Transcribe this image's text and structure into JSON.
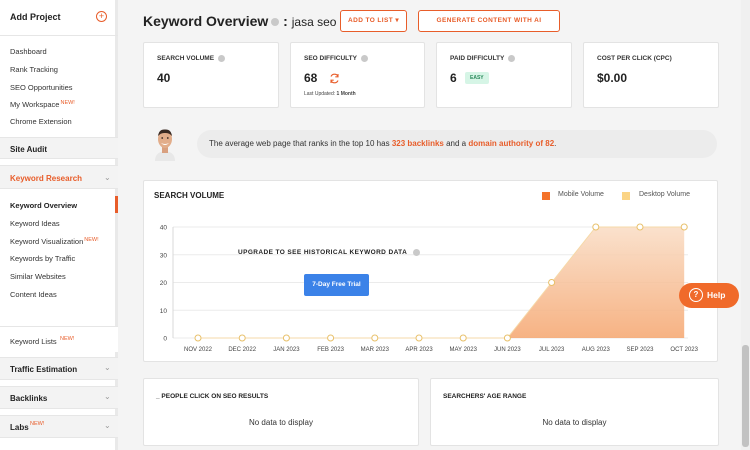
{
  "sidebar": {
    "add_project": "Add Project",
    "links_top": [
      {
        "label": "Dashboard",
        "new": ""
      },
      {
        "label": "Rank Tracking",
        "new": ""
      },
      {
        "label": "SEO Opportunities",
        "new": ""
      },
      {
        "label": "My Workspace",
        "new": "NEW!"
      },
      {
        "label": "Chrome Extension",
        "new": ""
      }
    ],
    "site_audit": "Site Audit",
    "keyword_research": "Keyword Research",
    "kr_links": [
      {
        "label": "Keyword Overview",
        "new": ""
      },
      {
        "label": "Keyword Ideas",
        "new": ""
      },
      {
        "label": "Keyword Visualization",
        "new": "NEW!"
      },
      {
        "label": "Keywords by Traffic",
        "new": ""
      },
      {
        "label": "Similar Websites",
        "new": ""
      },
      {
        "label": "Content Ideas",
        "new": ""
      }
    ],
    "keyword_lists": {
      "label": "Keyword Lists",
      "new": "NEW!"
    },
    "traffic_estimation": "Traffic Estimation",
    "backlinks": "Backlinks",
    "labs": {
      "label": "Labs",
      "new": "NEW!"
    }
  },
  "header": {
    "title": "Keyword Overview",
    "separator": ":",
    "keyword": "jasa seo",
    "add_to_list": "ADD TO LIST",
    "generate": "GENERATE CONTENT WITH AI"
  },
  "metrics": {
    "search_volume": {
      "label": "SEARCH VOLUME",
      "value": "40"
    },
    "seo_difficulty": {
      "label": "SEO DIFFICULTY",
      "value": "68",
      "updated_label": "Last Updated:",
      "updated_value": "1 Month"
    },
    "paid_difficulty": {
      "label": "PAID DIFFICULTY",
      "value": "6",
      "badge": "EASY"
    },
    "cpc": {
      "label": "COST PER CLICK (CPC)",
      "value": "$0.00"
    }
  },
  "insight": {
    "prefix": "The average web page that ranks in the top 10 has",
    "backlinks": "323 backlinks",
    "middle": "and a",
    "authority": "domain authority of 82",
    "suffix": "."
  },
  "chart_panel": {
    "title": "SEARCH VOLUME",
    "upgrade": "UPGRADE TO SEE HISTORICAL KEYWORD DATA",
    "trial_button": "7-Day Free Trial"
  },
  "chart_data": {
    "type": "area",
    "categories": [
      "NOV 2022",
      "DEC 2022",
      "JAN 2023",
      "FEB 2023",
      "MAR 2023",
      "APR 2023",
      "MAY 2023",
      "JUN 2023",
      "JUL 2023",
      "AUG 2023",
      "SEP 2023",
      "OCT 2023"
    ],
    "series": [
      {
        "name": "Mobile Volume",
        "color": "#f4732a",
        "values": [
          0,
          0,
          0,
          0,
          0,
          0,
          0,
          0,
          0,
          0,
          0,
          0
        ]
      },
      {
        "name": "Desktop Volume",
        "color": "#fbd485",
        "values": [
          0,
          0,
          0,
          0,
          0,
          0,
          0,
          0,
          20,
          40,
          40,
          40
        ]
      }
    ],
    "y_ticks": [
      "0",
      "10",
      "20",
      "30",
      "40"
    ],
    "ylim": [
      0,
      40
    ],
    "grid": true,
    "legend_position": "top-right"
  },
  "help": {
    "label": "Help",
    "glyph": "?"
  },
  "bottom_panels": [
    {
      "title": "_ PEOPLE CLICK ON SEO RESULTS",
      "empty": "No data to display"
    },
    {
      "title": "SEARCHERS' AGE RANGE",
      "empty": "No data to display"
    }
  ],
  "colors": {
    "accent": "#e85d2a",
    "trial_blue": "#3b82e8",
    "help_orange": "#f06a2a"
  },
  "icons": {
    "add_project": "plus-circle-icon",
    "refresh": "refresh-arrows-icon",
    "help": "question-circle-icon",
    "chevron": "chevron-down-icon"
  }
}
